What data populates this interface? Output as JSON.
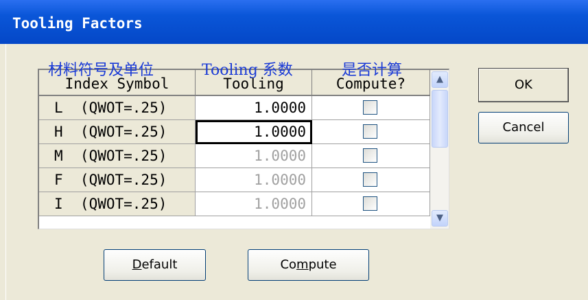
{
  "window": {
    "title": "Tooling Factors"
  },
  "table": {
    "headers": [
      "Index Symbol",
      "Tooling",
      "Compute?"
    ],
    "header_annotations": [
      "材料符号及单位",
      "Tooling 系数",
      "是否计算"
    ],
    "rows": [
      {
        "symbol": "L  (QWOT=.25)",
        "tooling": "1.0000",
        "compute": false,
        "enabled": true,
        "focused": false
      },
      {
        "symbol": "H  (QWOT=.25)",
        "tooling": "1.0000",
        "compute": false,
        "enabled": true,
        "focused": true
      },
      {
        "symbol": "M  (QWOT=.25)",
        "tooling": "1.0000",
        "compute": false,
        "enabled": false,
        "focused": false
      },
      {
        "symbol": "F  (QWOT=.25)",
        "tooling": "1.0000",
        "compute": false,
        "enabled": false,
        "focused": false
      },
      {
        "symbol": "I  (QWOT=.25)",
        "tooling": "1.0000",
        "compute": false,
        "enabled": false,
        "focused": false
      }
    ]
  },
  "buttons": {
    "ok": "OK",
    "cancel": "Cancel",
    "default": {
      "pre": "",
      "mnemonic": "D",
      "post": "efault"
    },
    "compute": {
      "pre": "Co",
      "mnemonic": "m",
      "post": "pute"
    }
  },
  "icons": {
    "scroll_up": "chevron-up-icon",
    "scroll_down": "chevron-down-icon"
  }
}
